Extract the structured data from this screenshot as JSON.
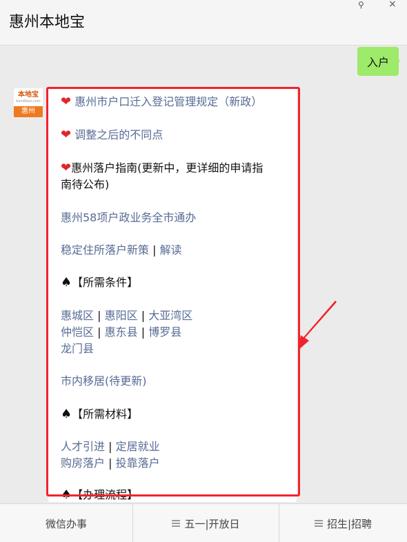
{
  "header": {
    "title": "惠州本地宝"
  },
  "user_message": "入户",
  "avatar": {
    "top_text": "本地宝",
    "sub_text": "bendibao.com",
    "bottom_text": "惠州"
  },
  "content": {
    "line1": "惠州市户口迁入登记管理规定（新政）",
    "line2": "调整之后的不同点",
    "line3a": "惠州落户指南(更新中，更详细的申请指",
    "line3b": "南待公布)",
    "line4": "惠州58项户政业务全市通办",
    "line5a": "稳定住所落户新策",
    "sep": "|",
    "line5b": "解读",
    "heading1": "【所需条件】",
    "districts_row1": [
      "惠城区",
      "惠阳区",
      "大亚湾区"
    ],
    "districts_row2": [
      "仲恺区",
      "惠东县",
      "博罗县"
    ],
    "districts_row3": "龙门县",
    "line_move": "市内移居(待更新)",
    "heading2": "【所需材料】",
    "materials_row1": [
      "人才引进",
      "定居就业"
    ],
    "materials_row2": [
      "购房落户",
      "投靠落户"
    ],
    "heading3": "【办理流程】"
  },
  "tabbar": {
    "tab1": "微信办事",
    "tab2": "五一|开放日",
    "tab3": "招生|招聘"
  },
  "colors": {
    "link": "#576b95",
    "highlight": "#f2222b",
    "bubble_green": "#9eea6a"
  }
}
